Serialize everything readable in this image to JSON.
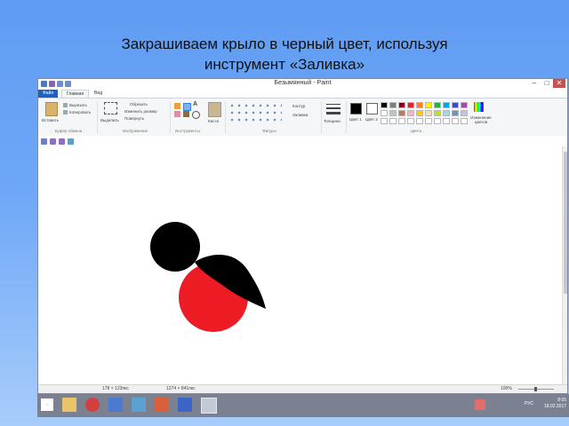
{
  "slide": {
    "title_line1": "Закрашиваем  крыло в черный цвет, используя",
    "title_line2": "инструмент «Заливка»"
  },
  "window": {
    "title": "Безымянный - Paint",
    "controls": [
      "–",
      "□",
      "✕"
    ]
  },
  "ribbon_tabs": {
    "file": "Файл",
    "home": "Главная",
    "view": "Вид"
  },
  "ribbon": {
    "clipboard": {
      "paste": "Вставить",
      "cut": "Вырезать",
      "copy": "Копировать",
      "group": "Буфер обмена"
    },
    "image": {
      "select": "Выделить",
      "crop": "Обрезать",
      "resize": "Изменить размер",
      "rotate": "Повернуть",
      "group": "Изображение"
    },
    "tools": {
      "group": "Инструменты",
      "brushes": "Кисти"
    },
    "shapes": {
      "outline": "Контур",
      "fill": "Заливка",
      "group": "Фигуры"
    },
    "size": "Толщина",
    "colors": {
      "color1": "Цвет 1",
      "color2": "Цвет 2",
      "edit": "Изменение цветов",
      "group": "Цвета"
    }
  },
  "palette": {
    "color1": "#000000",
    "color2": "#ffffff",
    "row1": [
      "#000000",
      "#7f7f7f",
      "#880015",
      "#ed1c24",
      "#ff7f27",
      "#fff200",
      "#22b14c",
      "#00a2e8",
      "#3f48cc",
      "#a349a4"
    ],
    "row2": [
      "#ffffff",
      "#c3c3c3",
      "#b97a57",
      "#ffaec9",
      "#ffc90e",
      "#efe4b0",
      "#b5e61d",
      "#99d9ea",
      "#7092be",
      "#c8bfe7"
    ],
    "row3": [
      "#ffffff",
      "#ffffff",
      "#ffffff",
      "#ffffff",
      "#ffffff",
      "#ffffff",
      "#ffffff",
      "#ffffff",
      "#ffffff",
      "#ffffff"
    ]
  },
  "drawing": {
    "head_color": "#000000",
    "body_color": "#ed1c24",
    "wing_color": "#000000"
  },
  "status": {
    "cursor_pos": "178 × 123пкс",
    "canvas_size": "1274 × 841пкс",
    "zoom": "100%"
  },
  "taskbar": {
    "lang": "РУС",
    "time": "8:05",
    "date": "18.02.2017"
  }
}
